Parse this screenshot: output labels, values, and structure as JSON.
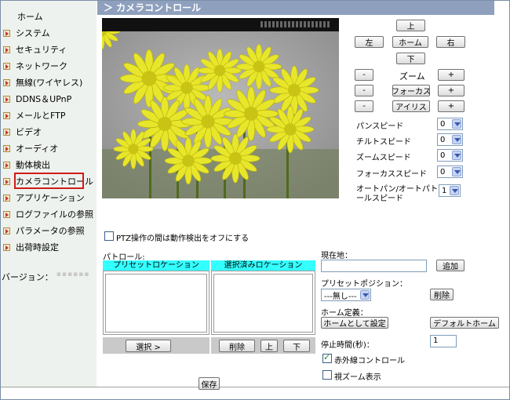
{
  "sidebar": {
    "home": "ホーム",
    "items": [
      {
        "label": "システム"
      },
      {
        "label": "セキュリティ"
      },
      {
        "label": "ネットワーク"
      },
      {
        "label": "無線(ワイヤレス)"
      },
      {
        "label": "DDNS＆UPnP"
      },
      {
        "label": "メールとFTP"
      },
      {
        "label": "ビデオ"
      },
      {
        "label": "オーディオ"
      },
      {
        "label": "動体検出"
      },
      {
        "label": "カメラコントロール"
      },
      {
        "label": "アプリケーション"
      },
      {
        "label": "ログファイルの参照"
      },
      {
        "label": "パラメータの参照"
      },
      {
        "label": "出荷時設定"
      }
    ],
    "version_label": "バージョン："
  },
  "header": {
    "title": "＞ カメラコントロール"
  },
  "ptz": {
    "up": "上",
    "left": "左",
    "home": "ホーム",
    "right": "右",
    "down": "下",
    "minus": "-",
    "plus": "+",
    "zoom": "ズーム",
    "focus": "フォーカス",
    "iris": "アイリス"
  },
  "speeds": {
    "pan": {
      "label": "パンスピード",
      "value": "0"
    },
    "tilt": {
      "label": "チルトスピード",
      "value": "0"
    },
    "zoom": {
      "label": "ズームスピード",
      "value": "0"
    },
    "focus": {
      "label": "フォーカススピード",
      "value": "0"
    },
    "autopan": {
      "label_line1": "オートパン/オートパトロ",
      "label_line2": "ールスピード",
      "value": "1"
    }
  },
  "ptz_disable_motion": {
    "label": "PTZ操作の間は動作検出をオフにする",
    "checked": false
  },
  "patrol": {
    "label": "パトロール:",
    "preset_header": "プリセットロケーション",
    "selected_header": "選択済みロケーション",
    "select_button": "選択 >",
    "delete_button": "削除",
    "up_button": "上",
    "down_button": "下"
  },
  "current": {
    "label": "現在地：",
    "value": "",
    "add_button": "追加"
  },
  "preset": {
    "label": "プリセットポジション：",
    "selected": "---無し---",
    "delete_button": "削除"
  },
  "home_def": {
    "label": "ホーム定義：",
    "set_button": "ホームとして設定",
    "default_button": "デフォルトホーム"
  },
  "dwell": {
    "label": "停止時間(秒)：",
    "value": "1"
  },
  "ir_control": {
    "label": "赤外線コントロール",
    "checked": true
  },
  "digital_zoom": {
    "label": "視ズーム表示",
    "checked": false
  },
  "save_button": "保存"
}
